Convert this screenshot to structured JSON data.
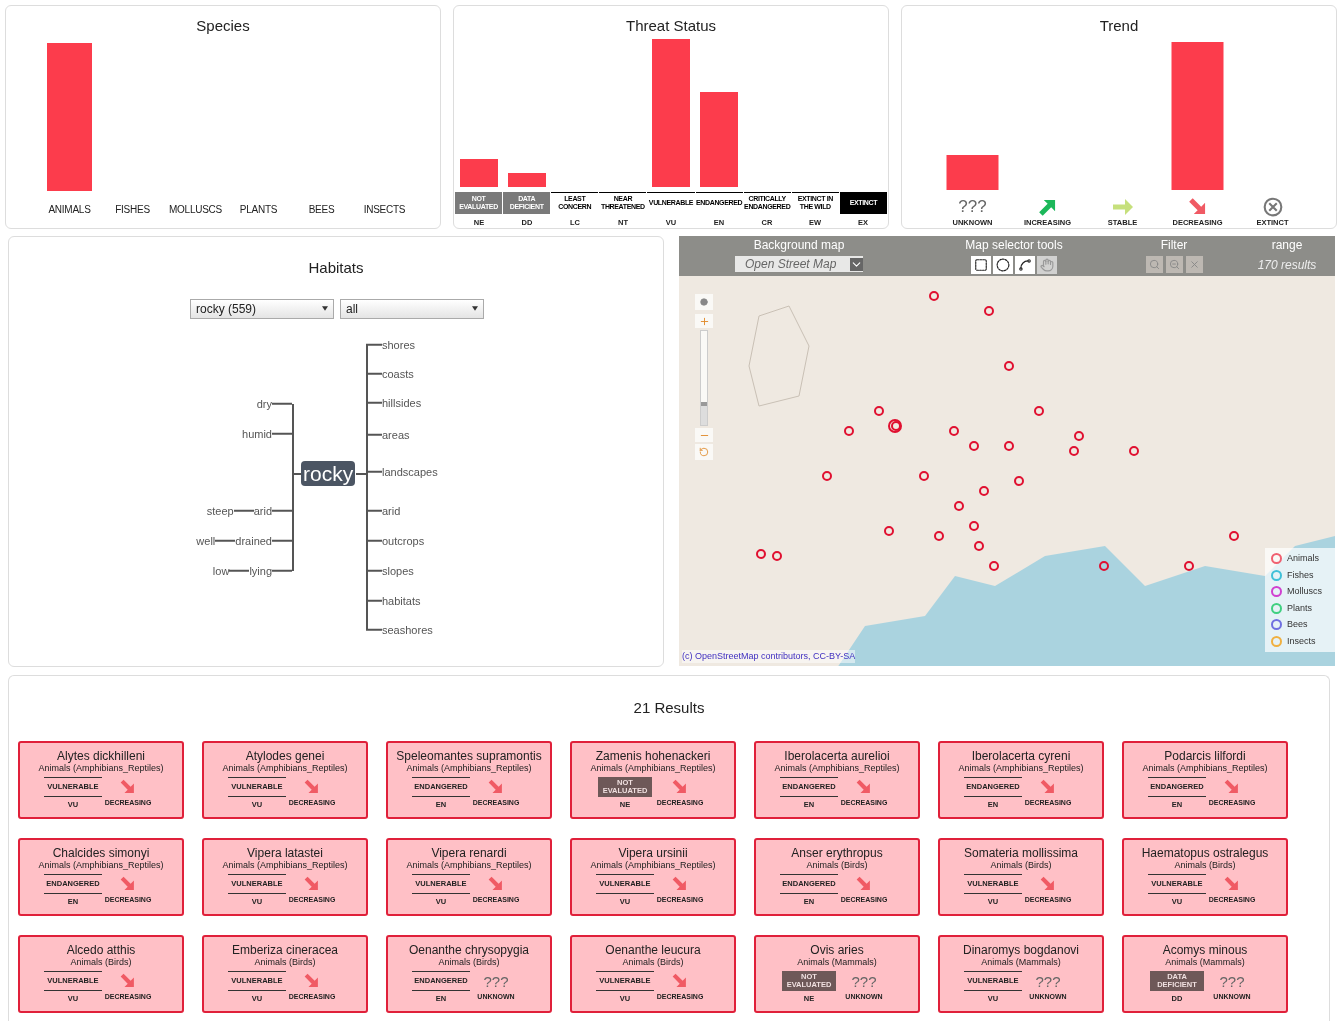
{
  "species": {
    "title": "Species",
    "categories": [
      {
        "label": "ANIMALS"
      },
      {
        "label": "FISHES"
      },
      {
        "label": "MOLLUSCS"
      },
      {
        "label": "PLANTS"
      },
      {
        "label": "BEES"
      },
      {
        "label": "INSECTS"
      }
    ]
  },
  "threat_status": {
    "title": "Threat Status",
    "categories": [
      {
        "label": "NOT EVALUATED",
        "code": "NE",
        "kind": "muted"
      },
      {
        "label": "DATA DEFICIENT",
        "code": "DD",
        "kind": "muted"
      },
      {
        "label": "LEAST CONCERN",
        "code": "LC",
        "kind": "plain"
      },
      {
        "label": "NEAR THREATENED",
        "code": "NT",
        "kind": "plain"
      },
      {
        "label": "VULNERABLE",
        "code": "VU",
        "kind": "plain"
      },
      {
        "label": "ENDANGERED",
        "code": "EN",
        "kind": "plain"
      },
      {
        "label": "CRITICALLY ENDANGERED",
        "code": "CR",
        "kind": "plain"
      },
      {
        "label": "EXTINCT IN THE WILD",
        "code": "EW",
        "kind": "plain"
      },
      {
        "label": "EXTINCT",
        "code": "EX",
        "kind": "dark"
      }
    ]
  },
  "trend": {
    "title": "Trend",
    "categories": [
      {
        "label": "UNKNOWN",
        "kind": "unknown",
        "symbol": "???"
      },
      {
        "label": "INCREASING",
        "kind": "increasing"
      },
      {
        "label": "STABLE",
        "kind": "stable"
      },
      {
        "label": "DECREASING",
        "kind": "decreasing"
      },
      {
        "label": "EXTINCT",
        "kind": "extinct"
      }
    ]
  },
  "habitats": {
    "title": "Habitats",
    "selects": [
      {
        "value": "rocky (559)"
      },
      {
        "value": "all"
      }
    ],
    "word_tree": {
      "root": "rocky",
      "left": [
        {
          "word": "dry"
        },
        {
          "word": "humid"
        },
        {
          "word": "arid",
          "children": [
            {
              "word": "steep"
            }
          ]
        },
        {
          "word": "drained",
          "children": [
            {
              "word": "well"
            }
          ]
        },
        {
          "word": "lying",
          "children": [
            {
              "word": "low"
            }
          ]
        }
      ],
      "right": [
        {
          "word": "shores"
        },
        {
          "word": "coasts"
        },
        {
          "word": "hillsides"
        },
        {
          "word": "areas"
        },
        {
          "word": "landscapes"
        },
        {
          "word": "arid"
        },
        {
          "word": "outcrops"
        },
        {
          "word": "slopes"
        },
        {
          "word": "habitats"
        },
        {
          "word": "seashores"
        }
      ]
    }
  },
  "map": {
    "zoom": {
      "level": 0.25
    },
    "background_map": {
      "label": "Background map",
      "value": "Open Street Map"
    },
    "selector_tools": {
      "label": "Map selector tools"
    },
    "filter": {
      "label": "Filter"
    },
    "range": {
      "label": "range",
      "value": "170 results"
    },
    "attribution": "(c) OpenStreetMap contributors, CC-BY-SA",
    "legend": [
      {
        "label": "Animals",
        "color": "#f06070"
      },
      {
        "label": "Fishes",
        "color": "#40c0d8"
      },
      {
        "label": "Molluscs",
        "color": "#d040d0"
      },
      {
        "label": "Plants",
        "color": "#40d080"
      },
      {
        "label": "Bees",
        "color": "#7070e0"
      },
      {
        "label": "Insects",
        "color": "#f0b040"
      }
    ]
  },
  "results": {
    "title": "21 Results",
    "items": [
      {
        "name": "Alytes dickhilleni",
        "group": "Animals (Amphibians_Reptiles)",
        "status": {
          "label": "VULNERABLE",
          "code": "VU",
          "kind": "plain"
        },
        "trend": {
          "label": "DECREASING",
          "kind": "decreasing"
        }
      },
      {
        "name": "Atylodes genei",
        "group": "Animals (Amphibians_Reptiles)",
        "status": {
          "label": "VULNERABLE",
          "code": "VU",
          "kind": "plain"
        },
        "trend": {
          "label": "DECREASING",
          "kind": "decreasing"
        }
      },
      {
        "name": "Speleomantes supramontis",
        "group": "Animals (Amphibians_Reptiles)",
        "status": {
          "label": "ENDANGERED",
          "code": "EN",
          "kind": "plain"
        },
        "trend": {
          "label": "DECREASING",
          "kind": "decreasing"
        }
      },
      {
        "name": "Zamenis hohenackeri",
        "group": "Animals (Amphibians_Reptiles)",
        "status": {
          "label": "NOT EVALUATED",
          "code": "NE",
          "kind": "muted"
        },
        "trend": {
          "label": "DECREASING",
          "kind": "decreasing"
        }
      },
      {
        "name": "Iberolacerta aurelioi",
        "group": "Animals (Amphibians_Reptiles)",
        "status": {
          "label": "ENDANGERED",
          "code": "EN",
          "kind": "plain"
        },
        "trend": {
          "label": "DECREASING",
          "kind": "decreasing"
        }
      },
      {
        "name": "Iberolacerta cyreni",
        "group": "Animals (Amphibians_Reptiles)",
        "status": {
          "label": "ENDANGERED",
          "code": "EN",
          "kind": "plain"
        },
        "trend": {
          "label": "DECREASING",
          "kind": "decreasing"
        }
      },
      {
        "name": "Podarcis lilfordi",
        "group": "Animals (Amphibians_Reptiles)",
        "status": {
          "label": "ENDANGERED",
          "code": "EN",
          "kind": "plain"
        },
        "trend": {
          "label": "DECREASING",
          "kind": "decreasing"
        }
      },
      {
        "name": "Chalcides simonyi",
        "group": "Animals (Amphibians_Reptiles)",
        "status": {
          "label": "ENDANGERED",
          "code": "EN",
          "kind": "plain"
        },
        "trend": {
          "label": "DECREASING",
          "kind": "decreasing"
        }
      },
      {
        "name": "Vipera latastei",
        "group": "Animals (Amphibians_Reptiles)",
        "status": {
          "label": "VULNERABLE",
          "code": "VU",
          "kind": "plain"
        },
        "trend": {
          "label": "DECREASING",
          "kind": "decreasing"
        }
      },
      {
        "name": "Vipera renardi",
        "group": "Animals (Amphibians_Reptiles)",
        "status": {
          "label": "VULNERABLE",
          "code": "VU",
          "kind": "plain"
        },
        "trend": {
          "label": "DECREASING",
          "kind": "decreasing"
        }
      },
      {
        "name": "Vipera ursinii",
        "group": "Animals (Amphibians_Reptiles)",
        "status": {
          "label": "VULNERABLE",
          "code": "VU",
          "kind": "plain"
        },
        "trend": {
          "label": "DECREASING",
          "kind": "decreasing"
        }
      },
      {
        "name": "Anser erythropus",
        "group": "Animals (Birds)",
        "status": {
          "label": "ENDANGERED",
          "code": "EN",
          "kind": "plain"
        },
        "trend": {
          "label": "DECREASING",
          "kind": "decreasing"
        }
      },
      {
        "name": "Somateria mollissima",
        "group": "Animals (Birds)",
        "status": {
          "label": "VULNERABLE",
          "code": "VU",
          "kind": "plain"
        },
        "trend": {
          "label": "DECREASING",
          "kind": "decreasing"
        }
      },
      {
        "name": "Haematopus ostralegus",
        "group": "Animals (Birds)",
        "status": {
          "label": "VULNERABLE",
          "code": "VU",
          "kind": "plain"
        },
        "trend": {
          "label": "DECREASING",
          "kind": "decreasing"
        }
      },
      {
        "name": "Alcedo atthis",
        "group": "Animals (Birds)",
        "status": {
          "label": "VULNERABLE",
          "code": "VU",
          "kind": "plain"
        },
        "trend": {
          "label": "DECREASING",
          "kind": "decreasing"
        }
      },
      {
        "name": "Emberiza cineracea",
        "group": "Animals (Birds)",
        "status": {
          "label": "VULNERABLE",
          "code": "VU",
          "kind": "plain"
        },
        "trend": {
          "label": "DECREASING",
          "kind": "decreasing"
        }
      },
      {
        "name": "Oenanthe chrysopygia",
        "group": "Animals (Birds)",
        "status": {
          "label": "ENDANGERED",
          "code": "EN",
          "kind": "plain"
        },
        "trend": {
          "label": "UNKNOWN",
          "kind": "unknown",
          "symbol": "???"
        }
      },
      {
        "name": "Oenanthe leucura",
        "group": "Animals (Birds)",
        "status": {
          "label": "VULNERABLE",
          "code": "VU",
          "kind": "plain"
        },
        "trend": {
          "label": "DECREASING",
          "kind": "decreasing"
        }
      },
      {
        "name": "Ovis aries",
        "group": "Animals (Mammals)",
        "status": {
          "label": "NOT EVALUATED",
          "code": "NE",
          "kind": "muted"
        },
        "trend": {
          "label": "UNKNOWN",
          "kind": "unknown",
          "symbol": "???"
        }
      },
      {
        "name": "Dinaromys bogdanovi",
        "group": "Animals (Mammals)",
        "status": {
          "label": "VULNERABLE",
          "code": "VU",
          "kind": "plain"
        },
        "trend": {
          "label": "UNKNOWN",
          "kind": "unknown",
          "symbol": "???"
        }
      },
      {
        "name": "Acomys minous",
        "group": "Animals (Mammals)",
        "status": {
          "label": "DATA DEFICIENT",
          "code": "DD",
          "kind": "muted"
        },
        "trend": {
          "label": "UNKNOWN",
          "kind": "unknown",
          "symbol": "???"
        }
      }
    ]
  }
}
